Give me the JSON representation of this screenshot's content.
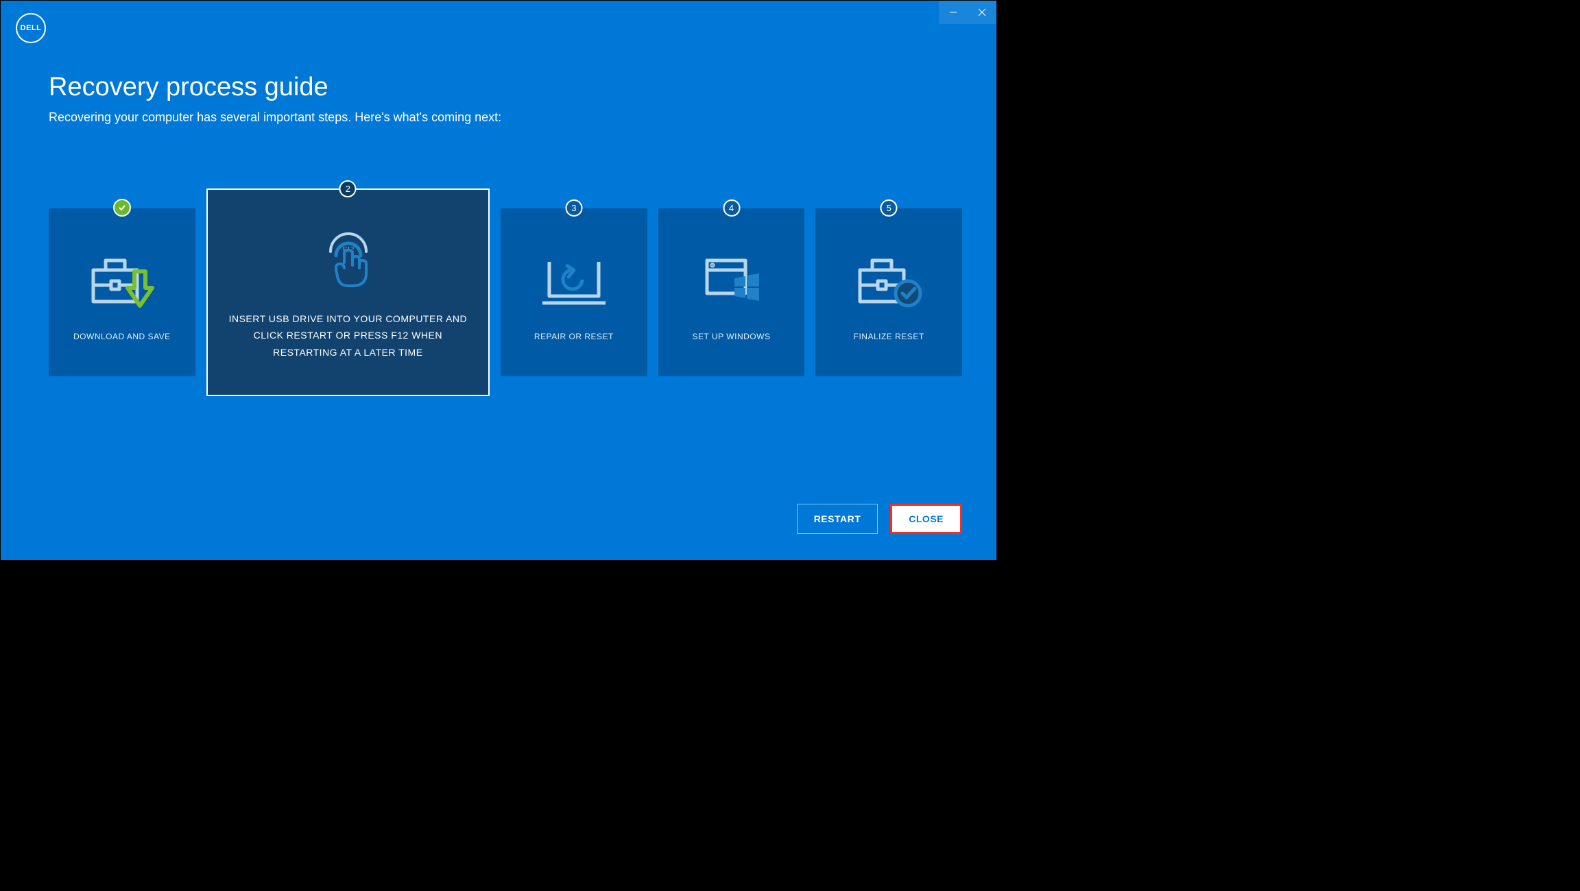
{
  "logo_text": "DELL",
  "heading": "Recovery process guide",
  "subheading": "Recovering your computer has several important steps. Here's what's coming next:",
  "steps": [
    {
      "label": "DOWNLOAD AND SAVE",
      "badge": "check"
    },
    {
      "label": "INSERT USB DRIVE INTO YOUR COMPUTER AND CLICK RESTART OR PRESS F12 WHEN RESTARTING AT A LATER TIME",
      "badge": "2",
      "f12_label": "F12"
    },
    {
      "label": "REPAIR OR RESET",
      "badge": "3"
    },
    {
      "label": "SET UP WINDOWS",
      "badge": "4"
    },
    {
      "label": "FINALIZE RESET",
      "badge": "5"
    }
  ],
  "buttons": {
    "restart": "RESTART",
    "close": "CLOSE"
  }
}
